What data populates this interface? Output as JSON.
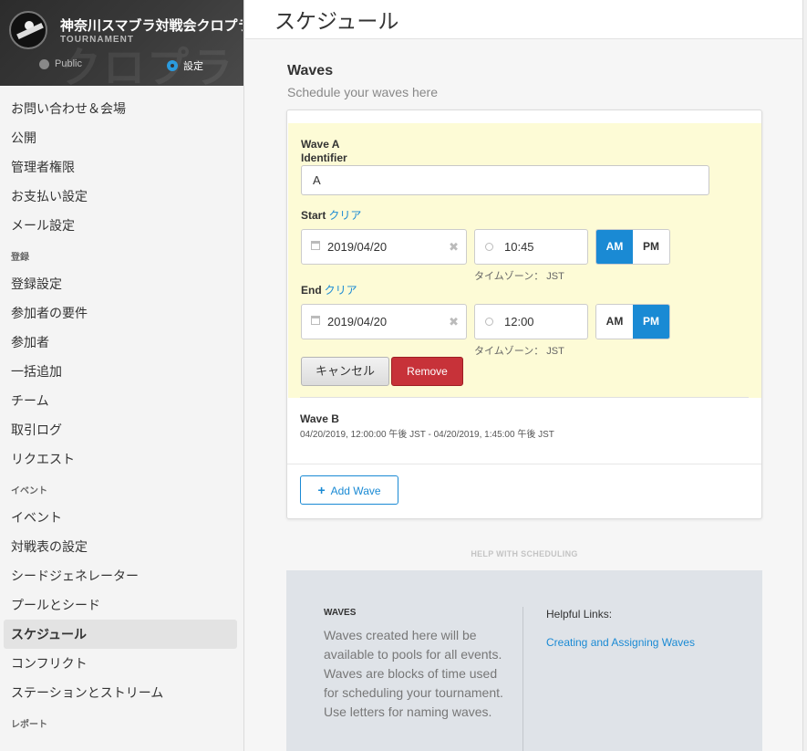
{
  "sidebar": {
    "tournament_name": "神奈川スマブラ対戦会クロプラ",
    "tournament_label": "TOURNAMENT",
    "public_tab": "Public",
    "settings_tab": "設定",
    "group1": [
      "お問い合わせ＆会場",
      "公開",
      "管理者権限",
      "お支払い設定",
      "メール設定"
    ],
    "section_registration": "登録",
    "group2": [
      "登録設定",
      "参加者の要件",
      "参加者",
      "一括追加",
      "チーム",
      "取引ログ",
      "リクエスト"
    ],
    "section_events": "イベント",
    "group3": [
      "イベント",
      "対戦表の設定",
      "シードジェネレーター",
      "プールとシード"
    ],
    "active_item": "スケジュール",
    "group4": [
      "コンフリクト",
      "ステーションとストリーム"
    ],
    "section_reports": "レポート"
  },
  "page_title": "スケジュール",
  "waves_section": {
    "title": "Waves",
    "subtitle": "Schedule your waves here"
  },
  "wave_a": {
    "title": "Wave A",
    "identifier_label": "Identifier",
    "identifier_value": "A",
    "start_label": "Start",
    "end_label": "End",
    "clear_link": "クリア",
    "start_date": "2019/04/20",
    "start_time": "10:45",
    "start_ampm": "AM",
    "end_date": "2019/04/20",
    "end_time": "12:00",
    "end_ampm": "PM",
    "timezone": "タイムゾーン： JST",
    "am": "AM",
    "pm": "PM",
    "cancel_label": "キャンセル",
    "remove_label": "Remove"
  },
  "wave_b": {
    "title": "Wave B",
    "time_range": "04/20/2019, 12:00:00 午後 JST - 04/20/2019, 1:45:00 午後 JST"
  },
  "add_wave_label": "Add Wave",
  "help": {
    "heading": "HELP WITH SCHEDULING",
    "waves_title": "WAVES",
    "waves_text": "Waves created here will be available to pools for all events. Waves are blocks of time used for scheduling your tournament. Use letters for naming waves.",
    "links_title": "Helpful Links:",
    "link_label": "Creating and Assigning Waves"
  },
  "colors": {
    "accent": "#1a8ad4",
    "remove": "#c73239",
    "wave_highlight": "#fdfbd6"
  }
}
